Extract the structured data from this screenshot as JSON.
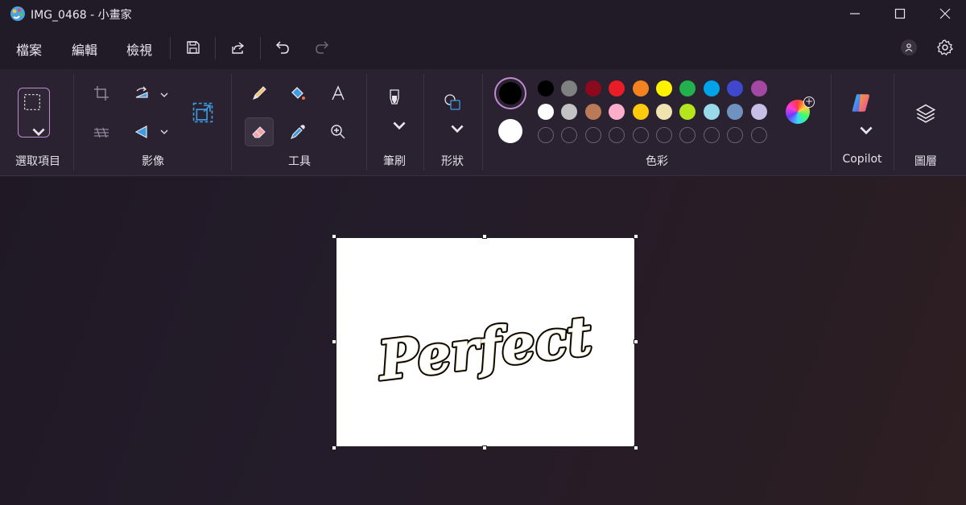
{
  "window": {
    "title": "IMG_0468 - 小畫家",
    "controls": [
      "minimize-icon",
      "maximize-icon",
      "close-icon"
    ]
  },
  "menu": {
    "file": "檔案",
    "edit": "編輯",
    "view": "檢視",
    "icons": [
      "save-icon",
      "share-icon",
      "undo-icon",
      "redo-icon"
    ]
  },
  "ribbon": {
    "groups": {
      "selection": "選取項目",
      "image": "影像",
      "tools": "工具",
      "brushes": "筆刷",
      "shapes": "形狀",
      "colors": "色彩",
      "copilot": "Copilot",
      "layers": "圖層"
    },
    "primary_color": "#000000",
    "secondary_color": "#ffffff",
    "palette_row1": [
      "#000000",
      "#808080",
      "#8b0a1e",
      "#e81d25",
      "#f58220",
      "#fff200",
      "#22b14c",
      "#00a2e8",
      "#3f48cc",
      "#a349a4"
    ],
    "palette_row2": [
      "#ffffff",
      "#c3c3c3",
      "#b97a57",
      "#ffaec9",
      "#ffc90e",
      "#efe4b0",
      "#b5e61d",
      "#99d9ea",
      "#7092be",
      "#c8bfe7"
    ],
    "palette_row3_empty": 10
  },
  "canvas": {
    "text": "Perfect"
  }
}
